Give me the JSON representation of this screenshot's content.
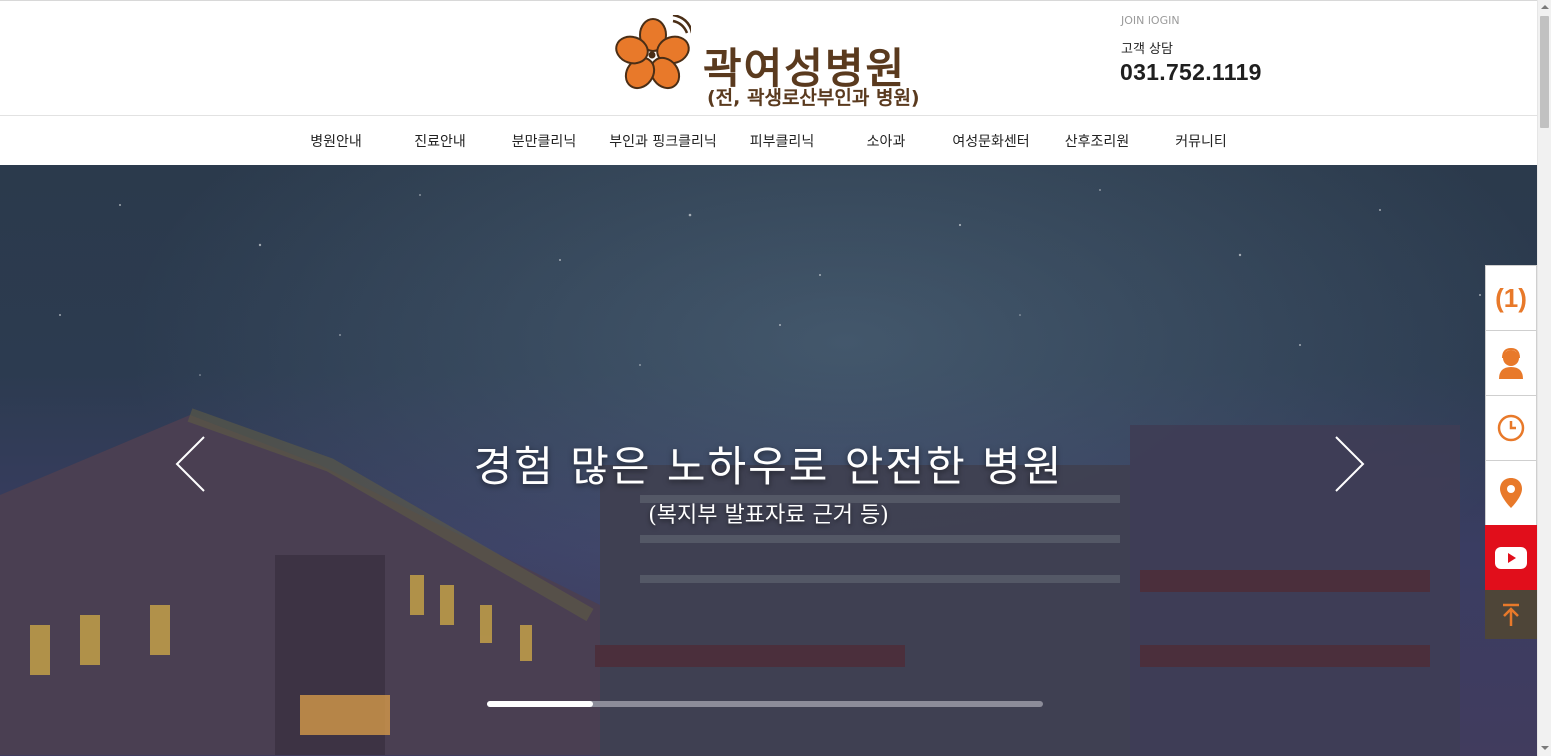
{
  "header": {
    "logo_name": "곽여성병원",
    "logo_sub": "(전, 곽생로산부인과 병원)",
    "join": "JOIN",
    "login": "lOGIN",
    "cs_label": "고객 상담",
    "cs_phone": "031.752.1119"
  },
  "nav": {
    "items": [
      {
        "label": "병원안내"
      },
      {
        "label": "진료안내"
      },
      {
        "label": "분만클리닉"
      },
      {
        "label": "부인과 핑크클리닉"
      },
      {
        "label": "피부클리닉"
      },
      {
        "label": "소아과"
      },
      {
        "label": "여성문화센터"
      },
      {
        "label": "산후조리원"
      },
      {
        "label": "커뮤니티"
      }
    ]
  },
  "hero": {
    "title": "경험 많은 노하우로 안전한 병원",
    "subtitle": "(복지부 발표자료 근거 등)",
    "progress": 0.19
  },
  "quick_menu": {
    "one_label": "1",
    "items": [
      "one-icon",
      "counselor-icon",
      "clock-icon",
      "location-pin-icon",
      "youtube-icon",
      "top-arrow-icon"
    ]
  },
  "colors": {
    "brand_brown": "#5a3a1e",
    "accent_orange": "#e8792a",
    "youtube_red": "#e10e1b",
    "top_button": "#4e4538"
  }
}
